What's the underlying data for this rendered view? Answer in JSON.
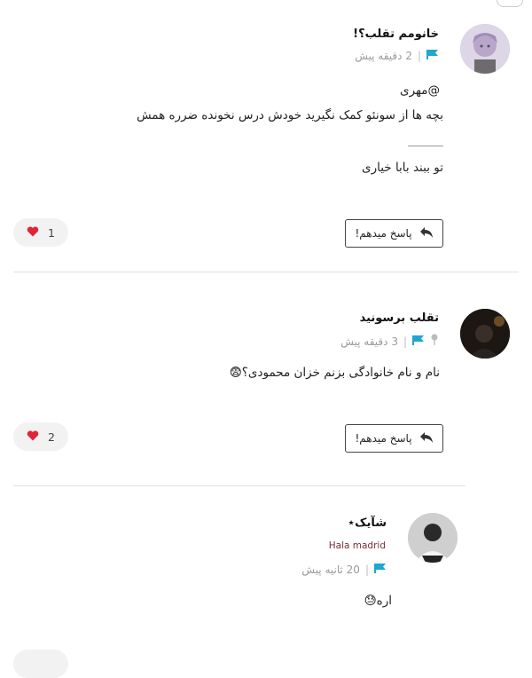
{
  "colors": {
    "accent": "#1ea7d0",
    "heart": "#e0243a",
    "divider": "#e2e2e2"
  },
  "comments": [
    {
      "author": "خانومم تقلب؟!",
      "time": "2 دقیقه پیش",
      "mention": "@مهری",
      "line1": "بچه ها از سونئو کمک نگیرید خودش درس نخونده ضرره همش",
      "line2": "تو ببند بابا خیاری",
      "reply_label": "پاسخ میدهم!",
      "likes": "1"
    },
    {
      "author": "تقلب برسونید",
      "time": "3 دقیقه پیش",
      "line1": "نام و نام خانوادگی بزنم خزان محمودی؟😨",
      "reply_label": "پاسخ میدهم!",
      "likes": "2"
    },
    {
      "author": "شآیک⋆",
      "subtitle": "Hala madrid",
      "time": "20 ثانیه پیش",
      "line1": "اره😓"
    }
  ]
}
